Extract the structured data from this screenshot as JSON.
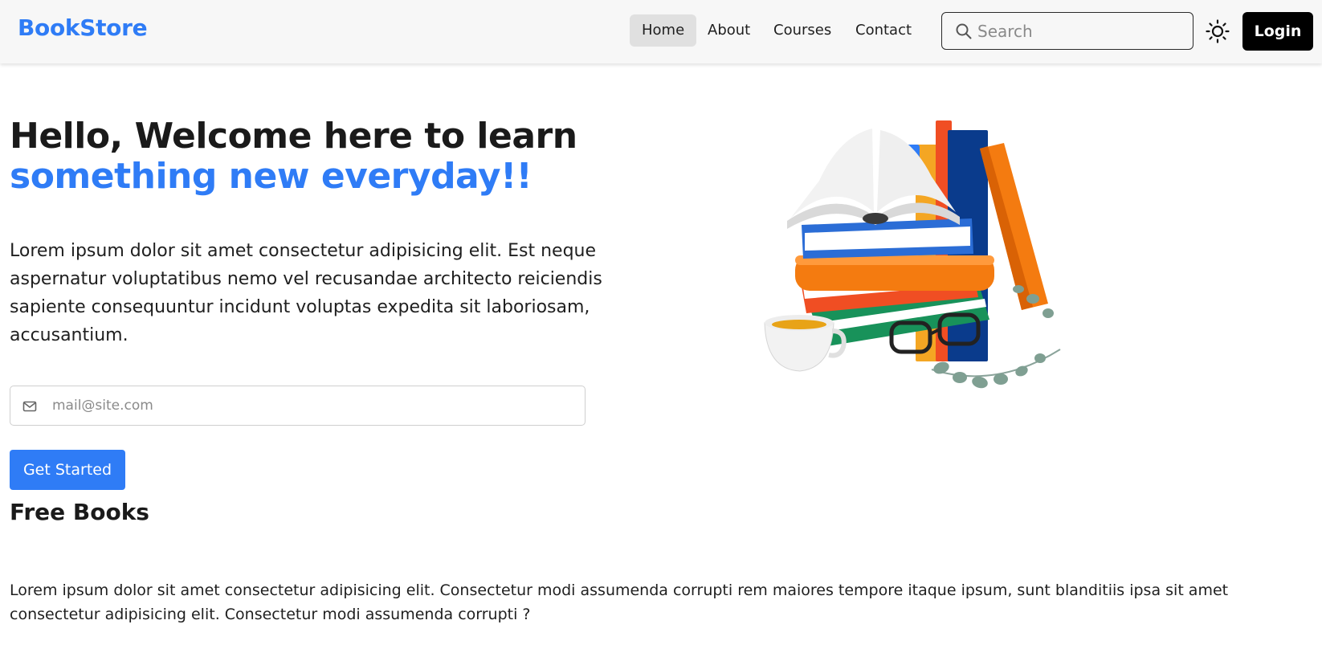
{
  "brand": {
    "name": "BookStore",
    "color": "#2f7cf6"
  },
  "nav": {
    "items": [
      {
        "label": "Home",
        "active": true
      },
      {
        "label": "About",
        "active": false
      },
      {
        "label": "Courses",
        "active": false
      },
      {
        "label": "Contact",
        "active": false
      }
    ],
    "search": {
      "placeholder": "Search",
      "icon": "search-icon"
    },
    "theme_toggle": {
      "icon": "sun-icon"
    },
    "login_label": "Login"
  },
  "hero": {
    "title_line1": "Hello, Welcome here to learn",
    "title_line2": "something new everyday!!",
    "accent_color": "#2f7cf6",
    "text": "Lorem ipsum dolor sit amet consectetur adipisicing elit. Est neque aspernatur voluptatibus nemo vel recusandae architecto reiciendis sapiente consequuntur incidunt voluptas expedita sit laboriosam, accusantium.",
    "email": {
      "placeholder": "mail@site.com",
      "value": "",
      "icon": "mail-icon"
    },
    "cta_label": "Get Started",
    "illustration": "books-illustration"
  },
  "free_books": {
    "title": "Free Books",
    "text": "Lorem ipsum dolor sit amet consectetur adipisicing elit. Consectetur modi assumenda corrupti rem maiores tempore itaque ipsum, sunt blanditiis ipsa sit amet consectetur adipisicing elit. Consectetur modi assumenda corrupti ?"
  }
}
